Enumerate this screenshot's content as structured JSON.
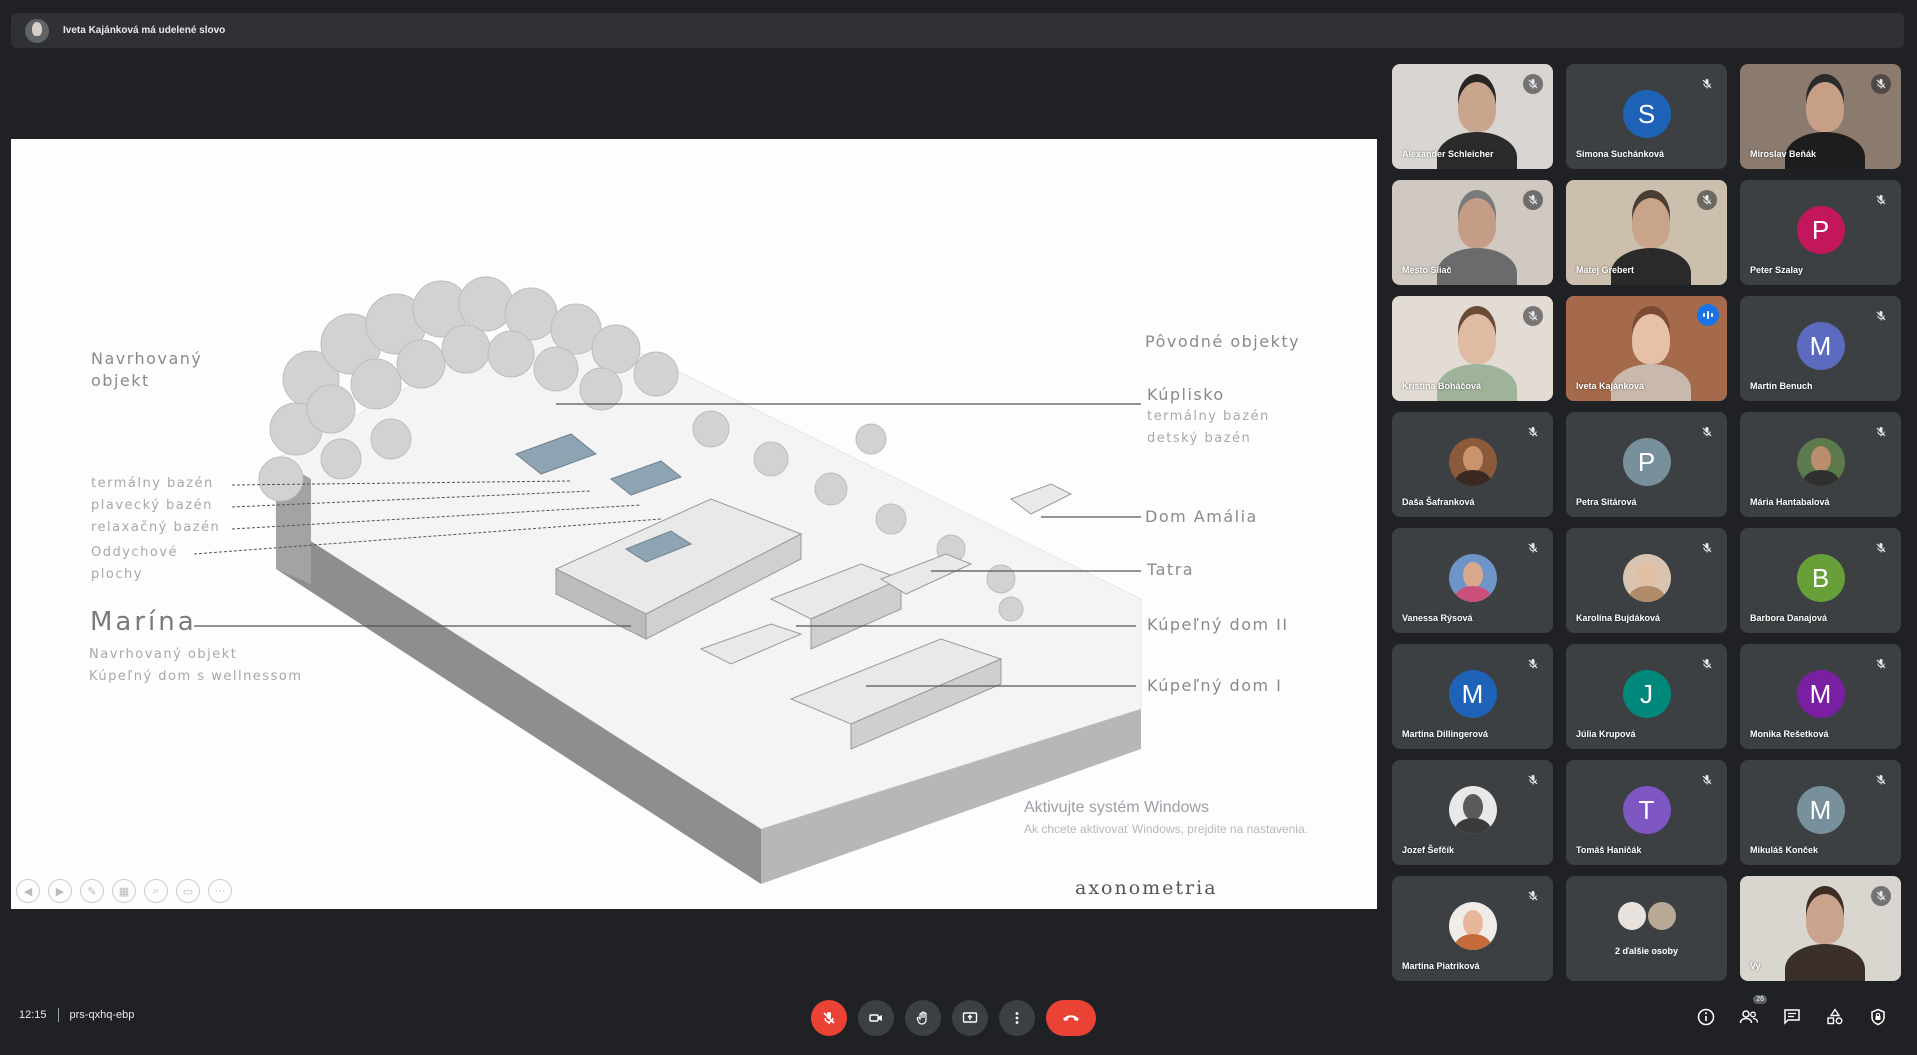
{
  "banner": {
    "text": "Iveta Kajánková má udelené slovo"
  },
  "slide": {
    "labels_left": {
      "navrhovany": "Navrhovaný",
      "objekt": "objekt",
      "termalny": "termálny bazén",
      "plavecky": "plavecký bazén",
      "relaxacny": "relaxačný bazén",
      "oddychove": "Oddychové",
      "plochy": "plochy",
      "marina": "Marína",
      "marina_sub1": "Navrhovaný objekt",
      "marina_sub2": "Kúpeľný dom s wellnessom"
    },
    "labels_right": {
      "povodne": "Pôvodné objekty",
      "kuplisko": "Kúplisko",
      "kuplisko_sub1": "termálny bazén",
      "kuplisko_sub2": "detský bazén",
      "amalia": "Dom Amália",
      "tatra": "Tatra",
      "kupelny2": "Kúpeľný dom II",
      "kupelny1": "Kúpeľný dom I"
    },
    "caption": "axonometria",
    "windows_title": "Aktivujte systém Windows",
    "windows_sub": "Ak chcete aktivovať Windows, prejdite na nastavenia."
  },
  "participants": [
    {
      "name": "Alexander Schleicher",
      "kind": "video",
      "bg": "#d9d6d2",
      "skin": "#c9a58e",
      "shirt": "#2b2b2b",
      "hair": "#2a2522"
    },
    {
      "name": "Simona Suchánková",
      "kind": "letter",
      "letter": "S",
      "color": "#1e63b8"
    },
    {
      "name": "Miroslav Beňák",
      "kind": "video",
      "bg": "#8a7b6e",
      "skin": "#c79f86",
      "shirt": "#1d1d1d",
      "hair": "#2b2b2b"
    },
    {
      "name": "Mesto Sliač",
      "kind": "video",
      "bg": "#cfc9c2",
      "skin": "#c59c85",
      "shirt": "#6b6b6b",
      "hair": "#7a7a7a"
    },
    {
      "name": "Matej Grebert",
      "kind": "video",
      "bg": "#cdbfae",
      "skin": "#c7a48a",
      "shirt": "#2a2a2a",
      "hair": "#4a3d33"
    },
    {
      "name": "Peter Szalay",
      "kind": "letter",
      "letter": "P",
      "color": "#c2185b"
    },
    {
      "name": "Kristína Boháčová",
      "kind": "video",
      "bg": "#e2dcd4",
      "skin": "#e0bba3",
      "shirt": "#9fb39a",
      "hair": "#6a4b36"
    },
    {
      "name": "Iveta Kajánková",
      "kind": "video",
      "bg": "#a56a4b",
      "skin": "#e6c1a8",
      "shirt": "#c9b9ac",
      "hair": "#7a4a32",
      "speaking": true
    },
    {
      "name": "Martin Benuch",
      "kind": "letter",
      "letter": "M",
      "color": "#5c6bc0"
    },
    {
      "name": "Daša Šafranková",
      "kind": "photo",
      "bg": "#8a5a3a",
      "skin": "#c9936e",
      "shirt": "#3a2a22"
    },
    {
      "name": "Petra Sitárová",
      "kind": "letter",
      "letter": "P",
      "color": "#78909c"
    },
    {
      "name": "Mária Hantabalová",
      "kind": "photo",
      "bg": "#5d7a4d",
      "skin": "#b98d6e",
      "shirt": "#2f2f2f"
    },
    {
      "name": "Vanessa Rýsová",
      "kind": "photo",
      "bg": "#6f95c8",
      "skin": "#d8a98c",
      "shirt": "#c9507a"
    },
    {
      "name": "Karolína Bujdáková",
      "kind": "photo",
      "bg": "#d8c4b0",
      "skin": "#e3bfa2",
      "shirt": "#b08b6a"
    },
    {
      "name": "Barbora Danajová",
      "kind": "letter",
      "letter": "B",
      "color": "#689f38"
    },
    {
      "name": "Martina Dillingerová",
      "kind": "letter",
      "letter": "M",
      "color": "#1e63b8"
    },
    {
      "name": "Júlia Krupová",
      "kind": "letter",
      "letter": "J",
      "color": "#00897b"
    },
    {
      "name": "Monika Rešetková",
      "kind": "letter",
      "letter": "M",
      "color": "#7b1fa2"
    },
    {
      "name": "Jozef Šefčík",
      "kind": "photo",
      "bg": "#e8e8e8",
      "skin": "#5a5a5a",
      "shirt": "#3a3a3a"
    },
    {
      "name": "Tomáš Haničák",
      "kind": "letter",
      "letter": "T",
      "color": "#7e57c2"
    },
    {
      "name": "Mikuláš Konček",
      "kind": "letter",
      "letter": "M",
      "color": "#78909c"
    },
    {
      "name": "Martina Piatriková",
      "kind": "photo",
      "bg": "#f0ede8",
      "skin": "#e8b79b",
      "shirt": "#c56a3a"
    },
    {
      "name": "2 ďalšie osoby",
      "kind": "more"
    },
    {
      "name": "Vy",
      "kind": "video",
      "bg": "#d9d6d0",
      "skin": "#caa48e",
      "shirt": "#3a2f2a",
      "hair": "#3d2b24"
    }
  ],
  "bottom_bar": {
    "time": "12:15",
    "meeting_code": "prs-qxhq-ebp",
    "participant_count": "26"
  },
  "colors": {
    "background": "#202124",
    "tile": "#3c4043",
    "danger": "#ea4335",
    "accent": "#8ab4f8"
  }
}
